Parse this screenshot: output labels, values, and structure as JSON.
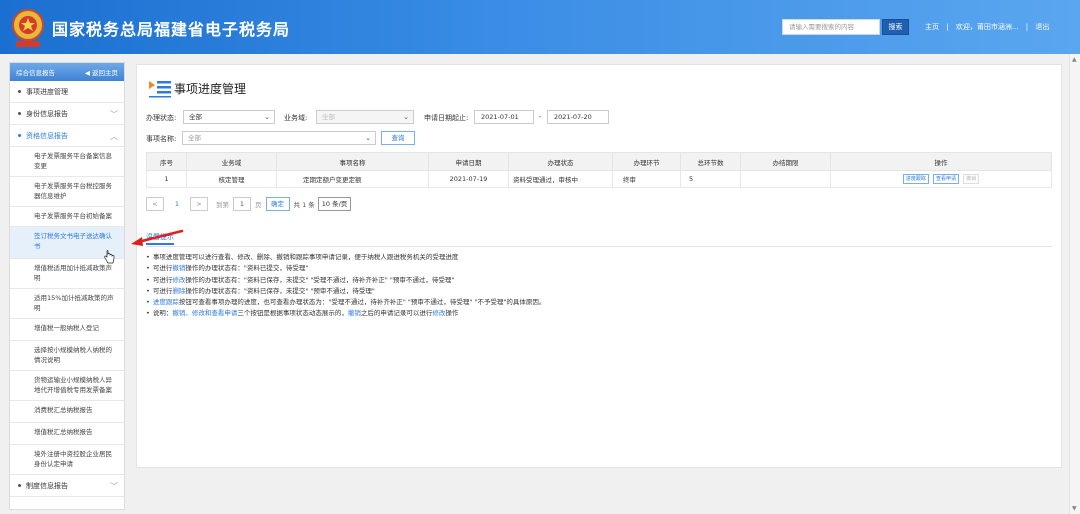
{
  "header": {
    "title": "国家税务总局福建省电子税务局",
    "search_placeholder": "请输入需要搜索的内容",
    "search_button": "搜索",
    "links": [
      "主页",
      "欢迎，莆田市涵洲...",
      "退出"
    ],
    "separator": "|"
  },
  "sidebar": {
    "head_left": "综合信息报告",
    "head_right": "◀ 返回主页",
    "items": [
      {
        "label": "事项进度管理",
        "active": false,
        "chevron": ""
      },
      {
        "label": "身份信息报告",
        "active": false,
        "chevron": "﹀"
      },
      {
        "label": "资格信息报告",
        "active": true,
        "chevron": "︿"
      }
    ],
    "sub_items": [
      "电子发票服务平台备案信息变更",
      "电子发票服务平台税控服务器信息维护",
      "电子发票服务平台初始备案",
      "签订税务文书电子送达确认书",
      "增值税适用加计抵减政策声明",
      "适用15%加计抵减政策的声明",
      "增值税一般纳税人登记",
      "选择按小规模纳税人纳税的情况说明",
      "货物运输业小规模纳税人异地代开增值税专用发票备案",
      "消费税汇总纳税报告",
      "增值税汇总纳税报告",
      "境外注册中资控股企业居民身份认定申请"
    ],
    "last_item": {
      "label": "制度信息报告",
      "chevron": "﹀"
    }
  },
  "main": {
    "title": "事项进度管理",
    "filters": {
      "status_label": "办理状态:",
      "status_value": "全部",
      "domain_label": "业务域:",
      "domain_value": "全部",
      "date_label": "申请日期起止:",
      "date_from": "2021-07-01",
      "date_dash": "-",
      "date_to": "2021-07-20",
      "item_label": "事项名称:",
      "item_value": "全部",
      "query_button": "查询"
    },
    "table": {
      "headers": [
        "序号",
        "业务域",
        "事项名称",
        "申请日期",
        "办理状态",
        "办理环节",
        "总环节数",
        "办结期限",
        "操作"
      ],
      "rows": [
        {
          "no": "1",
          "domain": "核定管理",
          "name": "定期定额户变更定额",
          "date": "2021-07-19",
          "status": "资料受理通过，审核中",
          "step": "终审",
          "total": "5",
          "deadline": "",
          "ops": [
            "进度跟踪",
            "查看申请",
            "撤销"
          ]
        }
      ]
    },
    "pager": {
      "prev": "<",
      "page": "1",
      "next": ">",
      "goto_label": "到第",
      "goto_value": "1",
      "page_unit": "页",
      "ok": "确定",
      "total": "共 1 条",
      "size": "10 条/页"
    },
    "notes": {
      "title": "温馨提示",
      "lines": [
        [
          "事项进度管理可以进行查看、修改、删除、撤销和跟踪事项申请记录，便于纳税人跟进税务机关的受理进度"
        ],
        [
          "可进行",
          "撤销",
          "操作的办理状态有：\"资料已提交，待受理\""
        ],
        [
          "可进行",
          "修改",
          "操作的办理状态有：\"资料已保存，未提交\"  \"受理不通过，待补齐补正\"  \"预审不通过，待受理\""
        ],
        [
          "可进行",
          "删除",
          "操作的办理状态有：\"资料已保存，未提交\"  \"预审不通过，待受理\""
        ],
        [
          "",
          "进度跟踪",
          "按钮可查看事项办理的进度，也可查看办理状态为：\"受理不通过，待补齐补正\"  \"预审不通过，待受理\"  \"不予受理\"的具体原因。"
        ],
        [
          "说明：",
          "撤销、修改和查看申请",
          "三个按钮是根据事项状态动态展示的，",
          "撤销",
          "之后的申请记录可以进行",
          "修改",
          "操作"
        ]
      ]
    }
  },
  "colors": {
    "header_blue": "#2f80dc",
    "accent_blue": "#2d7be0",
    "arrow_red": "#e02020"
  }
}
